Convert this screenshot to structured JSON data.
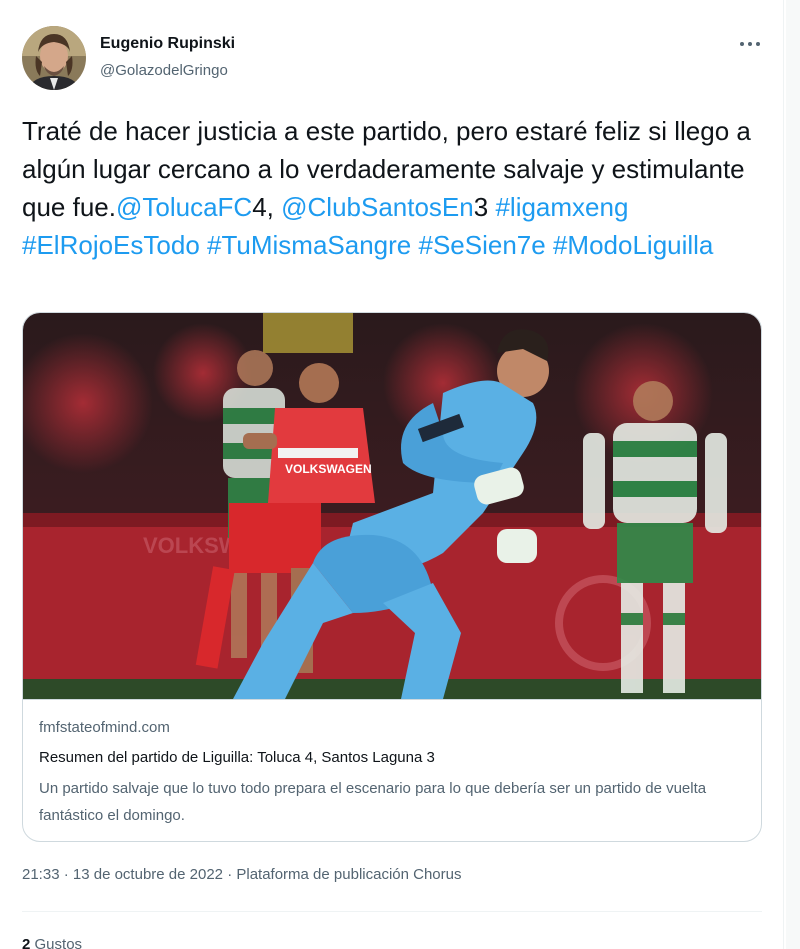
{
  "author": {
    "name": "Eugenio Rupinski",
    "handle": "@GolazodelGringo"
  },
  "tweet": {
    "text_plain_1": "Traté de hacer justicia a este partido, pero estaré feliz si llego a algún lugar cercano a lo verdaderamente salvaje y estimulante que fue.",
    "mention_1": "@TolucaFC",
    "text_plain_2": "4,",
    "mention_2": "@ClubSantosEn",
    "text_plain_3": "3",
    "hashtag_1": "#ligamxeng",
    "hashtag_2": "#ElRojoEsTodo",
    "hashtag_3": "#TuMismaSangre",
    "hashtag_4": "#SeSien7e",
    "hashtag_5": "#ModoLiguilla"
  },
  "card": {
    "domain": "fmfstateofmind.com",
    "title": "Resumen del partido de Liguilla: Toluca 4, Santos Laguna 3",
    "description": "Un partido salvaje que lo tuvo todo prepara el escenario para lo que debería ser un partido de vuelta fantástico el domingo.",
    "image_icon": "photo-goalkeeper-celebration",
    "jersey_text": "VOLKSWAGEN"
  },
  "meta": {
    "time": "21:33",
    "date": "13 de octubre de 2022",
    "source": "Plataforma de publicación Chorus",
    "separator": "·"
  },
  "stats": {
    "likes_count": "2",
    "likes_label": "Gustos"
  },
  "colors": {
    "link": "#1d9bf0",
    "secondary_text": "#536471",
    "border": "#cfd9de"
  }
}
